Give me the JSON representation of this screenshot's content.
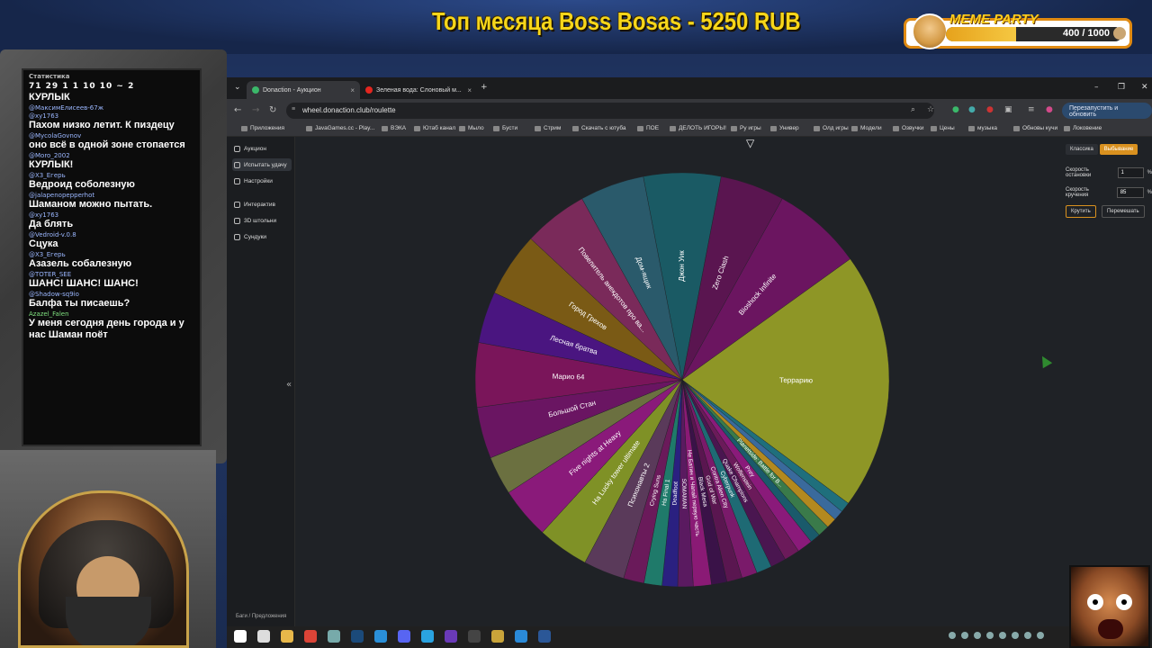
{
  "overlay": {
    "title": "Топ месяца Boss Bosas - 5250 RUB",
    "meme_label": "MEME PARTY",
    "meme_count": "400 / 1000",
    "meme_progress": 0.4
  },
  "chat": {
    "stats_title": "Статистика",
    "stats_row": "71 29 1 1 10 10 ~ 2",
    "messages": [
      {
        "user": "",
        "text": "КУРЛЫК"
      },
      {
        "user": "@МаксимЕлисеев-67ж",
        "text": ""
      },
      {
        "user": "@xy1763",
        "text": "Пахом низко летит. К пиздецу"
      },
      {
        "user": "@MycolaGovnov",
        "text": "оно всё в одной зоне стопается"
      },
      {
        "user": "@Moro_2002",
        "text": "КУРЛЫК!"
      },
      {
        "user": "@X3_Егерь",
        "text": "Ведроид соболезную"
      },
      {
        "user": "@jalapenopepperhot",
        "text": "Шаманом можно пытать."
      },
      {
        "user": "@xy1763",
        "text": "Да блять"
      },
      {
        "user": "@Vedroid-v.0.8",
        "text": "Сцука"
      },
      {
        "user": "@X3_Егерь",
        "text": "Азазель собалезную"
      },
      {
        "user": "@TOTER_SEE",
        "text": "ШАНС! ШАНС! ШАНС!"
      },
      {
        "user": "@Shadow-sq9io",
        "text": "Балфа ты писаешь?"
      },
      {
        "user": "Azazel_Falen",
        "text": "У меня сегодня день города и у нас Шаман поёт"
      }
    ]
  },
  "browser": {
    "tabs": [
      {
        "label": "Donaction - Аукцион",
        "active": true
      },
      {
        "label": "Зеленая вода: Слоновый м...",
        "active": false
      }
    ],
    "url": "wheel.donaction.club/roulette",
    "relaunch_label": "Перезапустить и обновить",
    "bookmarks": [
      "Приложения",
      "JavaGames.cc - Play...",
      "ВЭКА",
      "Ютаб канал",
      "Мыло",
      "Бусти",
      "Стрим",
      "Скачать с ютуба",
      "ПОЕ",
      "ДЕЛОТЬ ИГОРЫ!",
      "Ру игры",
      "Универ",
      "Олд игры",
      "Модели",
      "Озвучки",
      "Цены",
      "музыка",
      "Обновы кучи",
      "Локовение"
    ]
  },
  "sidebar": {
    "items": [
      {
        "label": "Аукцион",
        "active": false
      },
      {
        "label": "Испытать удачу",
        "active": true
      },
      {
        "label": "Настройки",
        "active": false
      },
      {
        "label": "Интерактив",
        "active": false
      },
      {
        "label": "3D штольни",
        "active": false
      },
      {
        "label": "Сундуки",
        "active": false
      }
    ],
    "footer": "Баги / Предложения"
  },
  "settings": {
    "mode_classic": "Классика",
    "mode_elimination": "Выбывание",
    "stop_speed_label": "Скорость остановки",
    "stop_speed_value": "1",
    "spin_speed_label": "Скорость кручения",
    "spin_speed_value": "85",
    "unit": "%",
    "spin_button": "Крутить",
    "shuffle_button": "Перемешать"
  },
  "wheel": {
    "segments": [
      {
        "label": "Джон Уик",
        "value": 6,
        "color": "#1a5a64"
      },
      {
        "label": "Zero Clash",
        "value": 5,
        "color": "#5a1550"
      },
      {
        "label": "Bioshock Infinite",
        "value": 7,
        "color": "#6b1560"
      },
      {
        "label": "Террарию",
        "value": 20,
        "color": "#8e9626"
      },
      {
        "label": "",
        "value": 0.8,
        "color": "#1f6f7c"
      },
      {
        "label": "",
        "value": 0.8,
        "color": "#3a6a9c"
      },
      {
        "label": "",
        "value": 0.8,
        "color": "#b3891f"
      },
      {
        "label": "Planetside: Battle for B...",
        "value": 0.9,
        "color": "#3a7a4a"
      },
      {
        "label": "",
        "value": 0.8,
        "color": "#1a5a6b"
      },
      {
        "label": "Prey",
        "value": 1.2,
        "color": "#8a1a7a"
      },
      {
        "label": "Wolfenstein",
        "value": 1.2,
        "color": "#6b1a5a"
      },
      {
        "label": "Quake Champions",
        "value": 1.2,
        "color": "#4a1650"
      },
      {
        "label": "Cyberpunk",
        "value": 1.2,
        "color": "#1e6a74"
      },
      {
        "label": "Contra Alien City",
        "value": 1.2,
        "color": "#7a1a6a"
      },
      {
        "label": "God of War",
        "value": 1.2,
        "color": "#5a1650"
      },
      {
        "label": "Black Mesa",
        "value": 1.2,
        "color": "#3a1248"
      },
      {
        "label": "Не Батин и Чапай первую часть",
        "value": 1.4,
        "color": "#8a1a75"
      },
      {
        "label": "SOMAMAN",
        "value": 1.2,
        "color": "#5a1a60"
      },
      {
        "label": "Deadfoot",
        "value": 1.2,
        "color": "#2a2080"
      },
      {
        "label": "На Final 1",
        "value": 1.4,
        "color": "#1f7a6a"
      },
      {
        "label": "Crying Suns",
        "value": 1.6,
        "color": "#6a1a5a"
      },
      {
        "label": "Психонавты 2",
        "value": 3.2,
        "color": "#5a3a5a"
      },
      {
        "label": "На Lucky tower ultimate",
        "value": 4,
        "color": "#7f9126"
      },
      {
        "label": "Five nights at Heavy",
        "value": 4,
        "color": "#8a1a7a"
      },
      {
        "label": "",
        "value": 3,
        "color": "#6b7040"
      },
      {
        "label": "Большой Стан",
        "value": 4,
        "color": "#6a1562"
      },
      {
        "label": "Марио 64",
        "value": 5,
        "color": "#7a155a"
      },
      {
        "label": "Лесная братва",
        "value": 4,
        "color": "#4a1580"
      },
      {
        "label": "Город Грехов",
        "value": 5,
        "color": "#7a5a15"
      },
      {
        "label": "Повелитель анекдотов про ва...",
        "value": 5,
        "color": "#7a2a5a"
      },
      {
        "label": "Дом-ящик",
        "value": 5,
        "color": "#2a5a6b"
      }
    ]
  },
  "taskbar": {
    "icons": [
      "windows-icon",
      "search-icon",
      "explorer-icon",
      "chrome-icon",
      "files-icon",
      "steam-icon",
      "edge-icon",
      "discord-icon",
      "telegram-icon",
      "vs-icon",
      "obs-icon",
      "app-icon",
      "vscode-icon",
      "word-icon"
    ]
  }
}
